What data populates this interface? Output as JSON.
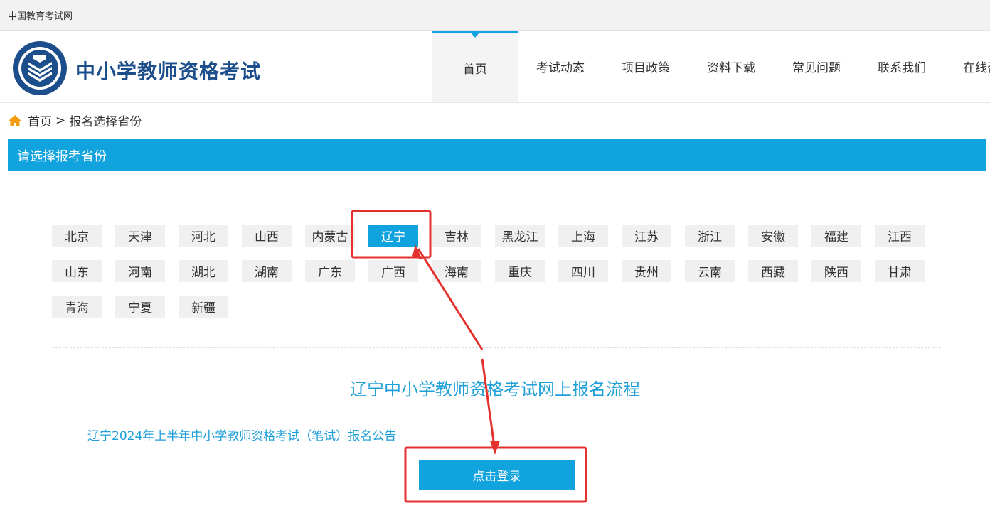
{
  "topbar": {
    "site_name": "中国教育考试网"
  },
  "header": {
    "title": "中小学教师资格考试",
    "nav": [
      {
        "label": "首页",
        "active": true
      },
      {
        "label": "考试动态",
        "active": false
      },
      {
        "label": "项目政策",
        "active": false
      },
      {
        "label": "资料下载",
        "active": false
      },
      {
        "label": "常见问题",
        "active": false
      },
      {
        "label": "联系我们",
        "active": false
      },
      {
        "label": "在线咨询",
        "active": false
      }
    ]
  },
  "breadcrumb": {
    "home": "首页",
    "separator": ">",
    "current": "报名选择省份"
  },
  "section": {
    "title": "请选择报考省份"
  },
  "provinces": [
    "北京",
    "天津",
    "河北",
    "山西",
    "内蒙古",
    "辽宁",
    "吉林",
    "黑龙江",
    "上海",
    "江苏",
    "浙江",
    "安徽",
    "福建",
    "江西",
    "山东",
    "河南",
    "湖北",
    "湖南",
    "广东",
    "广西",
    "海南",
    "重庆",
    "四川",
    "贵州",
    "云南",
    "西藏",
    "陕西",
    "甘肃",
    "青海",
    "宁夏",
    "新疆"
  ],
  "selected_province": "辽宁",
  "flow_title": "辽宁中小学教师资格考试网上报名流程",
  "notice_link": "辽宁2024年上半年中小学教师资格考试（笔试）报名公告",
  "login_button": "点击登录",
  "colors": {
    "accent": "#11a3de",
    "title_blue": "#1d4e8c",
    "annotation_red": "#e5312d"
  }
}
